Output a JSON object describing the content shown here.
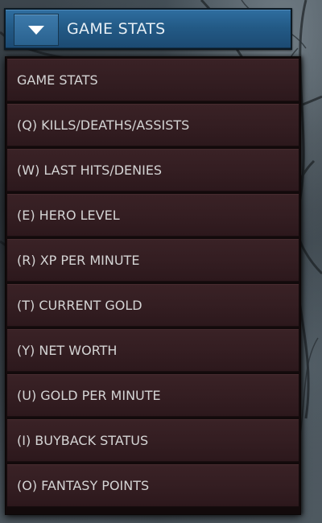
{
  "header": {
    "title": "GAME STATS",
    "toggle_icon": "chevron-down-icon"
  },
  "menu": {
    "items": [
      {
        "label": "GAME STATS"
      },
      {
        "label": "(Q) KILLS/DEATHS/ASSISTS"
      },
      {
        "label": "(W) LAST HITS/DENIES"
      },
      {
        "label": "(E) HERO LEVEL"
      },
      {
        "label": "(R) XP PER MINUTE"
      },
      {
        "label": "(T) CURRENT GOLD"
      },
      {
        "label": "(Y) NET WORTH"
      },
      {
        "label": "(U) GOLD PER MINUTE"
      },
      {
        "label": "(I) BUYBACK STATUS"
      },
      {
        "label": "(O) FANTASY POINTS"
      }
    ]
  },
  "colors": {
    "header_blue": "#235a86",
    "item_bg": "#331d21",
    "text": "#d4d4d4"
  }
}
